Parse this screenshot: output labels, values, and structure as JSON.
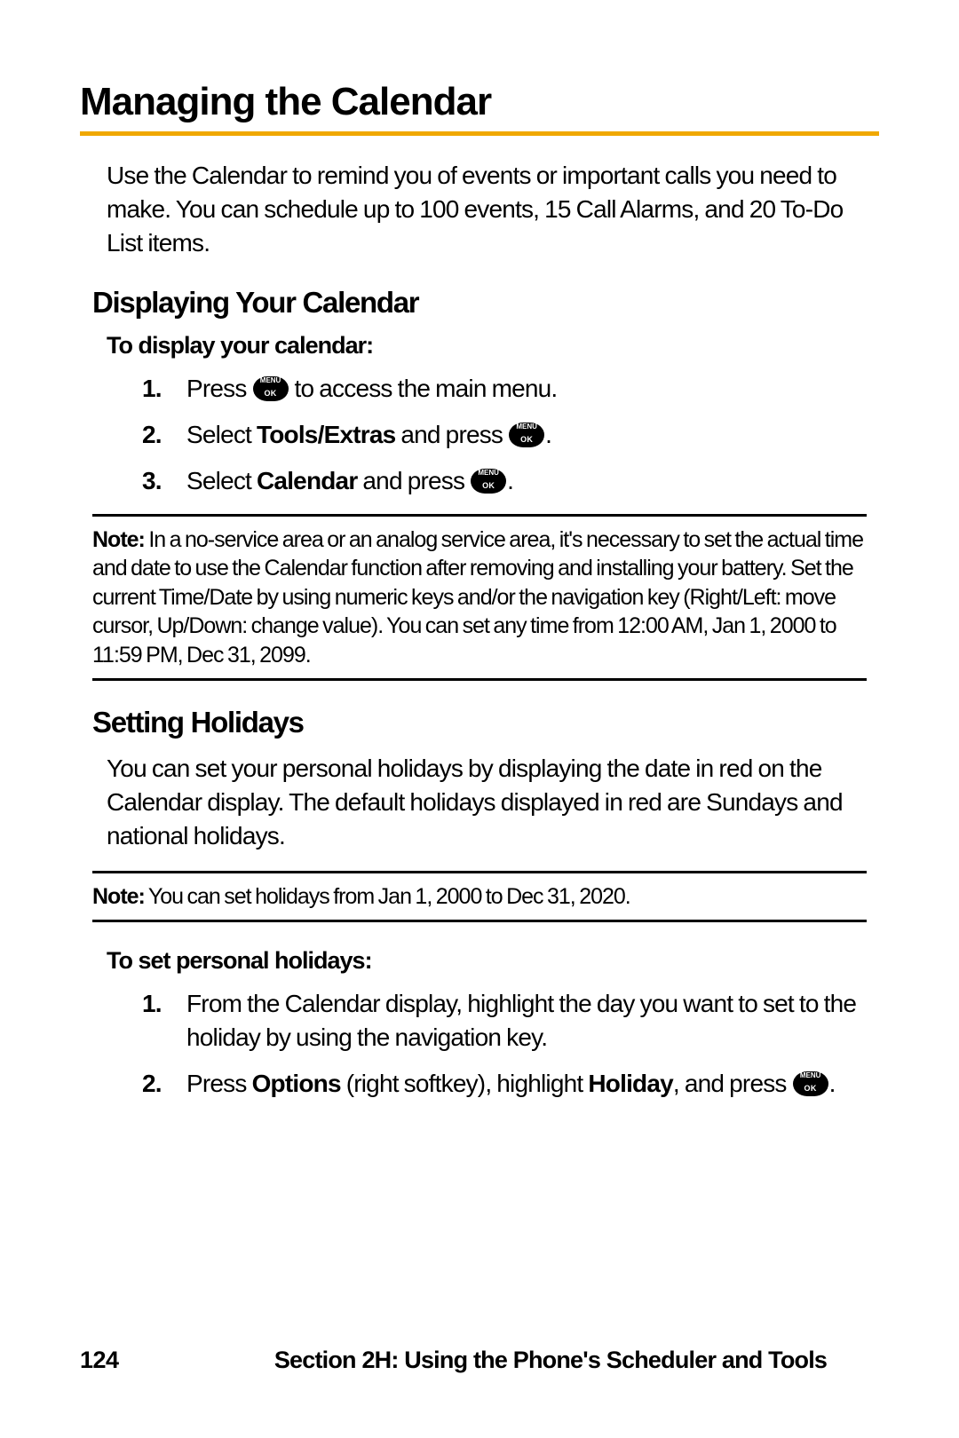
{
  "title": "Managing the Calendar",
  "intro": "Use the Calendar to remind you of events or important calls you need to make. You can schedule up to 100 events, 15 Call Alarms, and 20 To-Do List items.",
  "section1": {
    "heading": "Displaying Your Calendar",
    "subheading": "To display your calendar:",
    "steps": {
      "s1a": "Press ",
      "s1b": " to access the main menu.",
      "s2a": "Select ",
      "s2b": "Tools/Extras",
      "s2c": " and press ",
      "s2d": ".",
      "s3a": "Select ",
      "s3b": "Calendar",
      "s3c": " and press ",
      "s3d": "."
    }
  },
  "note1": {
    "label": "Note:",
    "text": " In a no-service area or an analog service area, it's necessary to set the actual time and date to use the Calendar function after removing and installing your battery. Set the current Time/Date by using numeric keys and/or the navigation key (Right/Left: move cursor, Up/Down: change value). You can set any time from 12:00 AM, Jan 1, 2000 to 11:59 PM, Dec 31, 2099."
  },
  "section2": {
    "heading": "Setting Holidays",
    "intro": "You can set your personal holidays by displaying the date in red on the Calendar display. The default holidays displayed in red are Sundays and national holidays."
  },
  "note2": {
    "label": "Note:",
    "text": " You can set holidays from Jan 1, 2000 to Dec 31, 2020."
  },
  "section3": {
    "subheading": "To set personal holidays:",
    "steps": {
      "s1": "From the Calendar display, highlight the day you want to set to the holiday by using the navigation key.",
      "s2a": "Press ",
      "s2b": "Options",
      "s2c": " (right softkey), highlight ",
      "s2d": "Holiday",
      "s2e": ", and press ",
      "s2f": "."
    }
  },
  "footer": {
    "page": "124",
    "section": "Section 2H: Using the Phone's Scheduler and Tools"
  }
}
